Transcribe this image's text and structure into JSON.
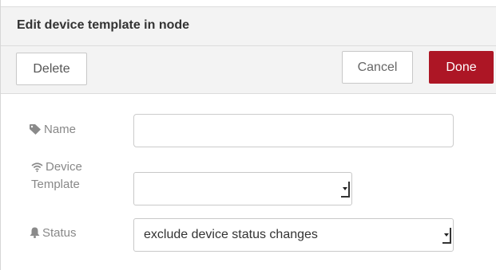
{
  "dialog": {
    "title": "Edit device template in node"
  },
  "toolbar": {
    "delete_label": "Delete",
    "cancel_label": "Cancel",
    "done_label": "Done"
  },
  "form": {
    "name": {
      "label": "Name",
      "icon": "tag-icon",
      "value": "",
      "placeholder": ""
    },
    "device_template": {
      "label_line1": "Device",
      "label_line2": "Template",
      "icon": "wifi-icon",
      "selected": ""
    },
    "status": {
      "label": "Status",
      "icon": "bell-icon",
      "selected": "exclude device status changes"
    }
  },
  "colors": {
    "done_button": "#ad1625",
    "header_bg": "#f3f3f3",
    "label_text": "#888888"
  }
}
